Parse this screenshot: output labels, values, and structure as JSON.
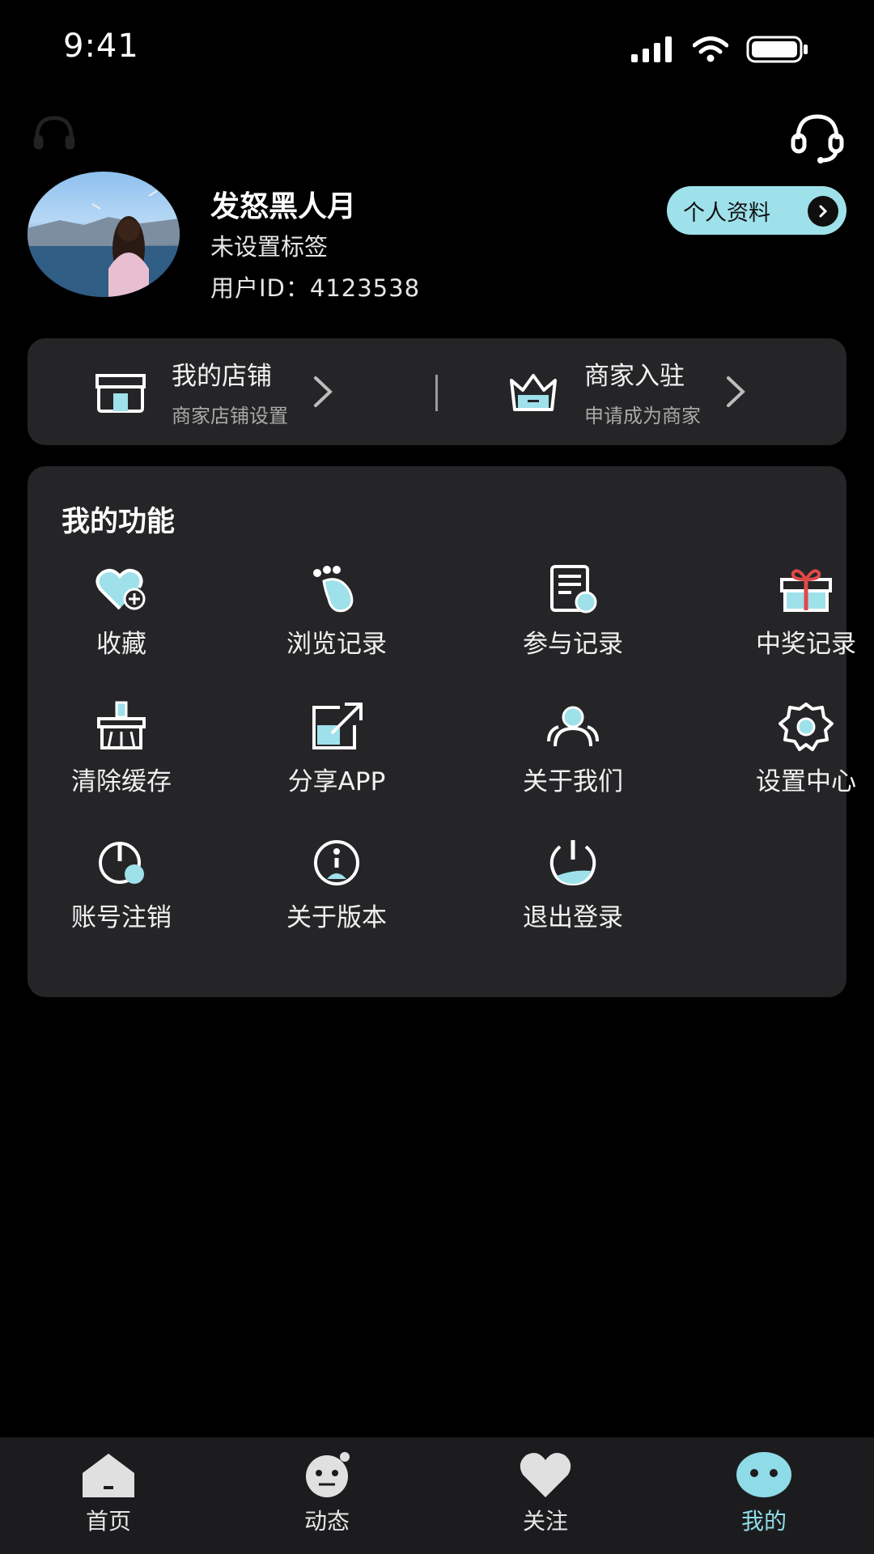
{
  "status_bar": {
    "time": "9:41"
  },
  "profile": {
    "name": "发怒黑人月",
    "tagline": "未设置标签",
    "user_id": "用户ID：4123538",
    "profile_button": "个人资料"
  },
  "store": {
    "my_store": {
      "title": "我的店铺",
      "subtitle": "商家店铺设置"
    },
    "merchant": {
      "title": "商家入驻",
      "subtitle": "申请成为商家"
    }
  },
  "functions": {
    "title": "我的功能",
    "items": [
      {
        "label": "收藏",
        "icon": "heart-plus-icon"
      },
      {
        "label": "浏览记录",
        "icon": "footprint-icon"
      },
      {
        "label": "参与记录",
        "icon": "document-icon"
      },
      {
        "label": "中奖记录",
        "icon": "gift-icon"
      },
      {
        "label": "清除缓存",
        "icon": "broom-icon"
      },
      {
        "label": "分享APP",
        "icon": "share-icon"
      },
      {
        "label": "关于我们",
        "icon": "users-icon"
      },
      {
        "label": "设置中心",
        "icon": "gear-icon"
      },
      {
        "label": "账号注销",
        "icon": "power-icon"
      },
      {
        "label": "关于版本",
        "icon": "info-icon"
      },
      {
        "label": "退出登录",
        "icon": "logout-icon"
      }
    ]
  },
  "tabbar": {
    "items": [
      {
        "label": "首页",
        "icon": "home-icon"
      },
      {
        "label": "动态",
        "icon": "moments-icon"
      },
      {
        "label": "关注",
        "icon": "heart-icon"
      },
      {
        "label": "我的",
        "icon": "profile-face-icon"
      }
    ],
    "active": "我的"
  },
  "colors": {
    "accent": "#9ee1ea",
    "card": "#252527",
    "background": "#000000"
  }
}
